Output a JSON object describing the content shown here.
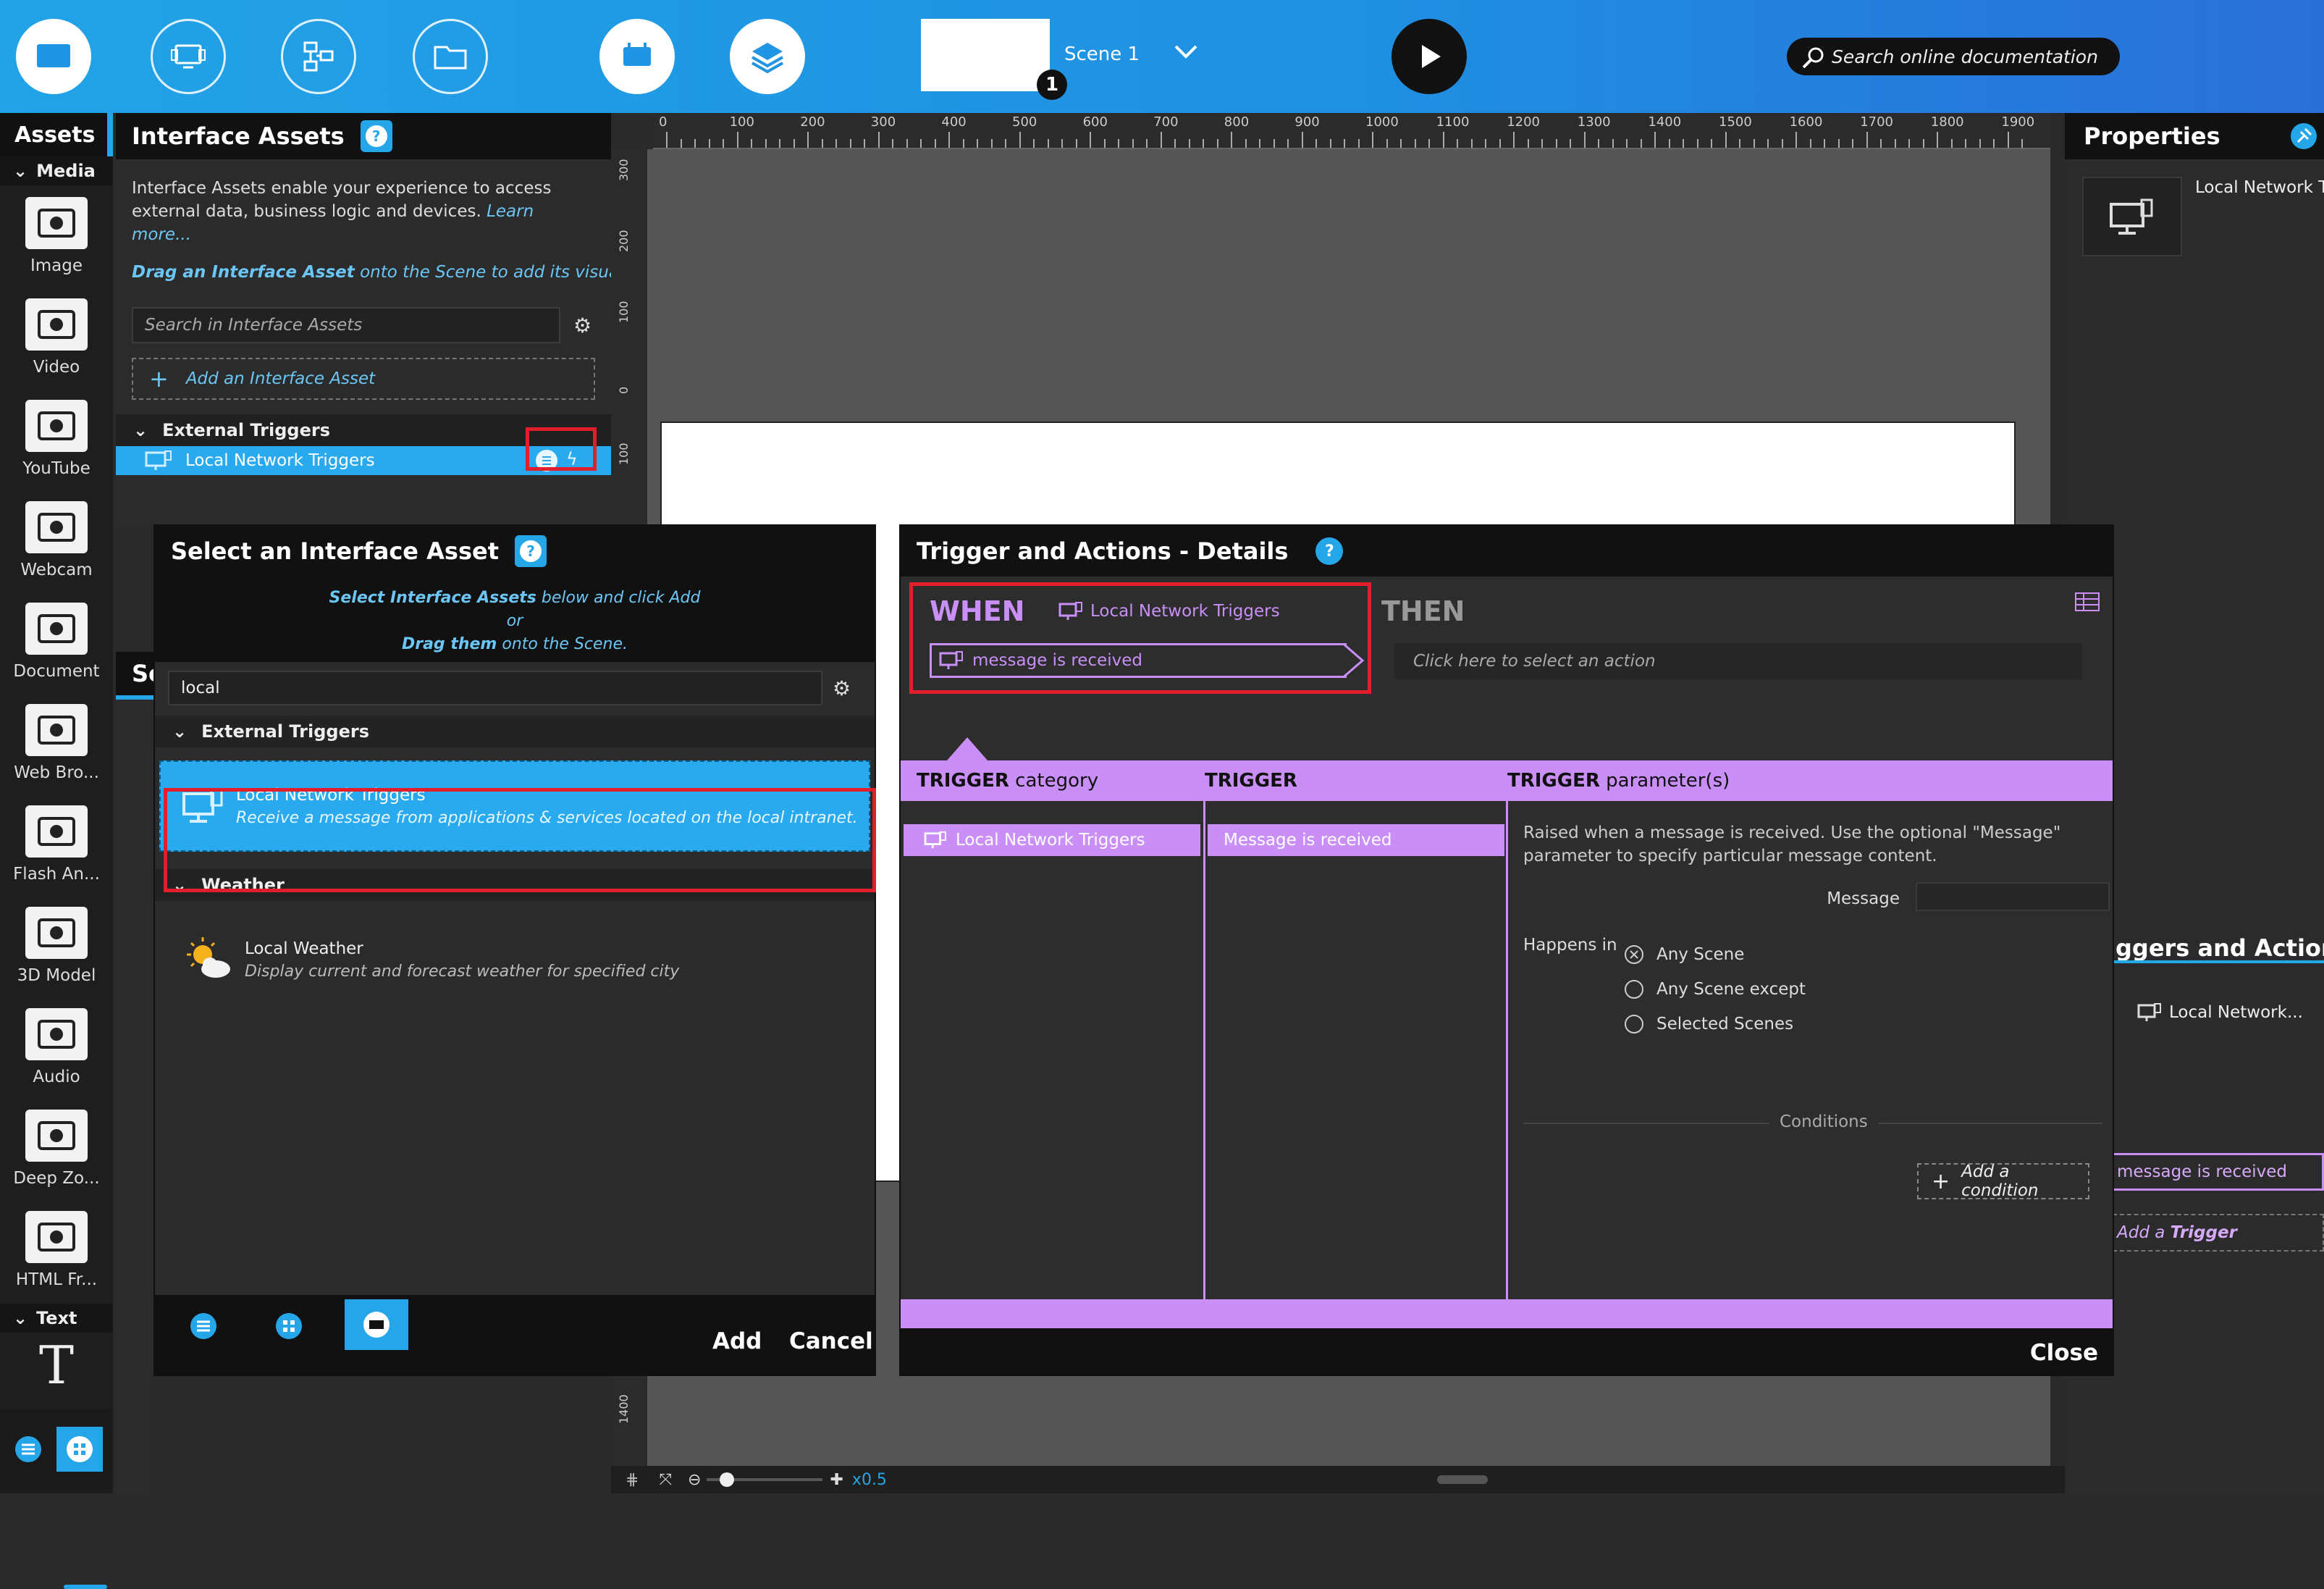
{
  "topbar": {
    "scene_name": "Scene 1",
    "scene_badge": "1",
    "search_placeholder": "Search online documentation"
  },
  "assets_sidebar": {
    "title": "Assets",
    "media_section": "Media",
    "items": [
      {
        "label": "Image",
        "icon": "image-icon"
      },
      {
        "label": "Video",
        "icon": "video-icon"
      },
      {
        "label": "YouTube",
        "icon": "youtube-icon"
      },
      {
        "label": "Webcam",
        "icon": "webcam-icon"
      },
      {
        "label": "Document",
        "icon": "document-icon"
      },
      {
        "label": "Web Bro...",
        "icon": "web-browser-icon"
      },
      {
        "label": "Flash An...",
        "icon": "flash-icon"
      },
      {
        "label": "3D Model",
        "icon": "3d-model-icon"
      },
      {
        "label": "Audio",
        "icon": "audio-icon"
      },
      {
        "label": "Deep Zo...",
        "icon": "deep-zoom-icon"
      },
      {
        "label": "HTML Fr...",
        "icon": "html-frame-icon"
      }
    ],
    "text_section": "Text"
  },
  "interface_assets": {
    "title": "Interface Assets",
    "help": "?",
    "description": "Interface Assets enable your experience to access external data, business logic and devices.",
    "learn_more": "Learn more...",
    "drag_hint_bold": "Drag an Interface Asset",
    "drag_hint_rest": "onto the Scene to add its visual re...",
    "search_placeholder": "Search in Interface Assets",
    "add_label": "Add an Interface Asset",
    "section": "External Triggers",
    "item": "Local Network Triggers",
    "partial_label_1": "Sc"
  },
  "ruler": {
    "ticks": [
      "0",
      "100",
      "200",
      "300",
      "400",
      "500",
      "600",
      "700",
      "800",
      "900",
      "1000",
      "1100",
      "1200",
      "1300",
      "1400",
      "1500",
      "1600",
      "1700",
      "1800",
      "1900"
    ],
    "vticks": [
      "300",
      "200",
      "100",
      "0",
      "100"
    ],
    "vtick_bottom": "1400"
  },
  "properties": {
    "title": "Properties",
    "item_label": "Local Network Tr",
    "triggers_title": "ggers and Actions",
    "trigger_source": "Local Network...",
    "trigger_event": "message is received",
    "add_trigger_prefix": "Add a",
    "add_trigger_bold": "Trigger"
  },
  "select_dialog": {
    "title": "Select an Interface Asset",
    "help": "?",
    "hint_line1_bold": "Select Interface Assets",
    "hint_line1_rest": "below and click Add",
    "hint_line2": "or",
    "hint_line3_bold": "Drag them",
    "hint_line3_rest": "onto the Scene.",
    "search_value": "local",
    "sections": [
      {
        "name": "External Triggers",
        "items": [
          {
            "title": "Local Network Triggers",
            "desc": "Receive a message from applications & services located on the local intranet."
          }
        ]
      },
      {
        "name": "Weather",
        "items": [
          {
            "title": "Local Weather",
            "desc": "Display current and forecast weather for specified city"
          }
        ]
      }
    ],
    "add_button": "Add",
    "cancel_button": "Cancel"
  },
  "trigger_dialog": {
    "title": "Trigger and Actions - Details",
    "help": "?",
    "when_label": "WHEN",
    "when_source": "Local Network Triggers",
    "when_event": "message is received",
    "then_label": "THEN",
    "then_placeholder": "Click here to select an action",
    "col1_bold": "TRIGGER",
    "col1_rest": "category",
    "col2_bold": "TRIGGER",
    "col3_bold": "TRIGGER",
    "col3_rest": "parameter(s)",
    "category_item": "Local Network Triggers",
    "trigger_item": "Message is received",
    "param_desc": "Raised when a message is received. Use the optional \"Message\" parameter to specify particular message content.",
    "message_label": "Message",
    "happens_in": "Happens in",
    "scene_options": [
      "Any Scene",
      "Any Scene except",
      "Selected Scenes"
    ],
    "selected_option": 0,
    "conditions_label": "Conditions",
    "add_condition": "Add a condition",
    "close_button": "Close"
  },
  "bottom_bar": {
    "zoom": "x0.5"
  },
  "colors": {
    "accent_blue": "#25a6e8",
    "violet": "#c98ff7",
    "highlight_red": "#e21d2c"
  }
}
